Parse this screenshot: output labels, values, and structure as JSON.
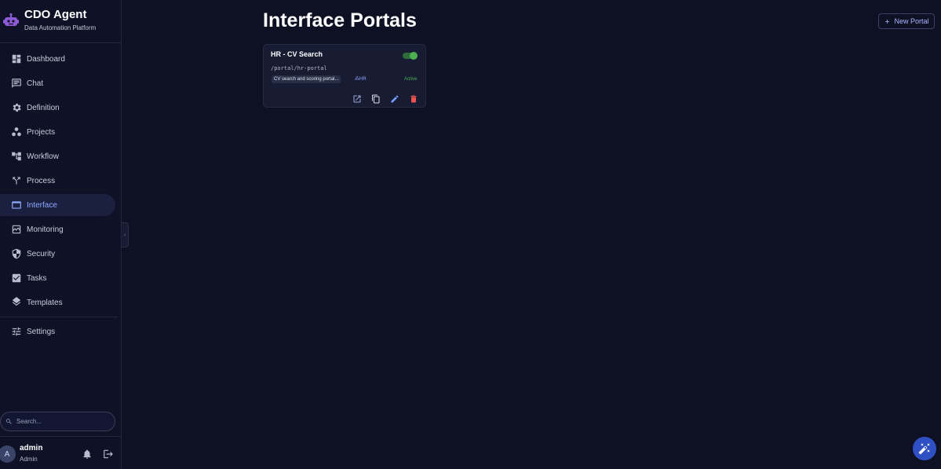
{
  "brand": {
    "title": "CDO Agent",
    "subtitle": "Data Automation Platform"
  },
  "nav": {
    "items": [
      {
        "label": "Dashboard",
        "icon": "dashboard-icon"
      },
      {
        "label": "Chat",
        "icon": "chat-icon"
      },
      {
        "label": "Definition",
        "icon": "gear-icon"
      },
      {
        "label": "Projects",
        "icon": "projects-icon"
      },
      {
        "label": "Workflow",
        "icon": "workflow-icon"
      },
      {
        "label": "Process",
        "icon": "fork-icon"
      },
      {
        "label": "Interface",
        "icon": "window-icon",
        "active": true
      },
      {
        "label": "Monitoring",
        "icon": "monitoring-icon"
      },
      {
        "label": "Security",
        "icon": "shield-icon"
      },
      {
        "label": "Tasks",
        "icon": "checkbox-icon"
      },
      {
        "label": "Templates",
        "icon": "layers-icon"
      }
    ],
    "settings": {
      "label": "Settings",
      "icon": "sliders-icon"
    }
  },
  "search": {
    "placeholder": "Search..."
  },
  "user": {
    "initial": "A",
    "name": "admin",
    "role": "Admin"
  },
  "page": {
    "title": "Interface Portals",
    "new_button_label": "New Portal"
  },
  "portals": [
    {
      "title": "HR - CV Search",
      "path": "/portal/hr-portal",
      "description": "CV search and scoring portal...",
      "tag": "HR",
      "status": "Active",
      "enabled": true
    }
  ],
  "colors": {
    "background": "#0e1124",
    "sidebar": "#0f1226",
    "accent": "#8fa8ff",
    "active_green": "#4caf50",
    "delete_red": "#ef5350",
    "edit_blue": "#7b9cff"
  }
}
